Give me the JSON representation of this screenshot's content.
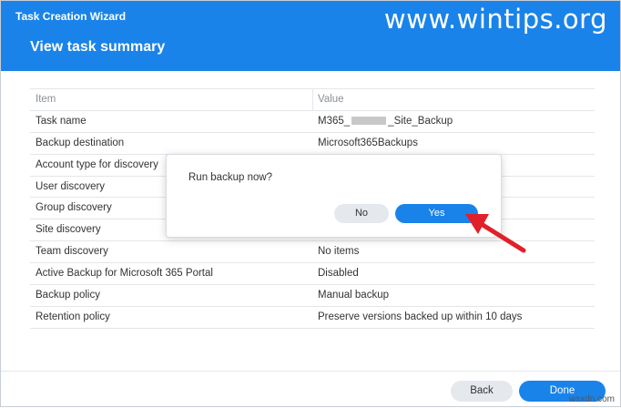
{
  "window": {
    "title": "Task Creation Wizard"
  },
  "watermark": "www.wintips.org",
  "page": {
    "title": "View task summary"
  },
  "table": {
    "columns": [
      "Item",
      "Value"
    ],
    "rows": [
      {
        "item": "Task name",
        "value_pre": "M365_",
        "value_post": "_Site_Backup"
      },
      {
        "item": "Backup destination",
        "value": "Microsoft365Backups"
      },
      {
        "item": "Account type for discovery",
        "value": ""
      },
      {
        "item": "User discovery",
        "value": ""
      },
      {
        "item": "Group discovery",
        "value": ""
      },
      {
        "item": "Site discovery",
        "value": ""
      },
      {
        "item": "Team discovery",
        "value": "No items"
      },
      {
        "item": "Active Backup for Microsoft 365 Portal",
        "value": "Disabled"
      },
      {
        "item": "Backup policy",
        "value": "Manual backup"
      },
      {
        "item": "Retention policy",
        "value": "Preserve versions backed up within 10 days"
      }
    ]
  },
  "dialog": {
    "message": "Run backup now?",
    "no_label": "No",
    "yes_label": "Yes"
  },
  "footer": {
    "back_label": "Back",
    "done_label": "Done"
  },
  "credit": "wsxdn.com",
  "colors": {
    "accent": "#1a83ea",
    "arrow": "#e0202a"
  }
}
